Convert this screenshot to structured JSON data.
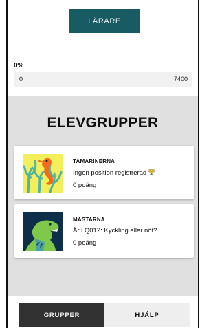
{
  "top": {
    "teacher_button": "LÄRARE",
    "progress": {
      "percent_label": "0%",
      "value": 0,
      "min_label": "0",
      "max_label": "7400"
    }
  },
  "groups": {
    "title": "ELEVGRUPPER",
    "items": [
      {
        "name": "TAMARINERNA",
        "status": "Ingen position registrerad",
        "status_icon": "trophy-icon",
        "points": "0 poäng",
        "image": "seahorse-coral-image"
      },
      {
        "name": "MÄSTARNA",
        "status": "Är i Q012: Kyckling eller nöt?",
        "points": "0 poäng",
        "image": "dinosaur-image"
      }
    ]
  },
  "tabs": {
    "groups": "GRUPPER",
    "help": "HJÄLP"
  },
  "colors": {
    "accent": "#195b63",
    "tab_active": "#323232",
    "tab_inactive": "#eeeeee",
    "groups_bg": "#e0e0e0"
  }
}
